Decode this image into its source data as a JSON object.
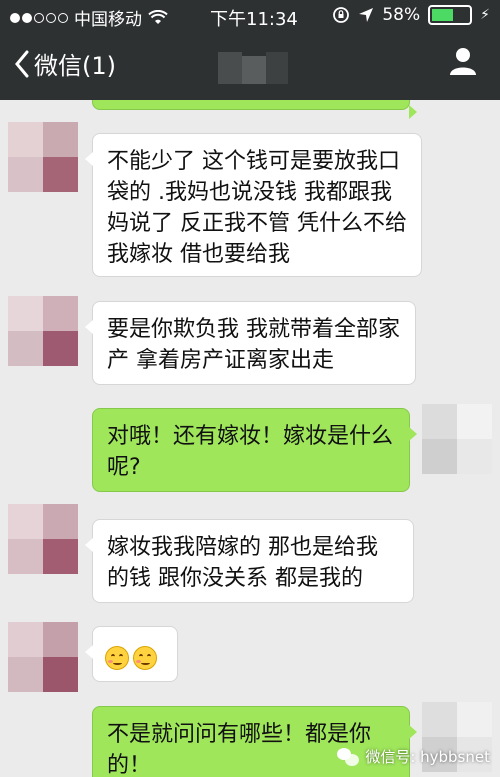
{
  "status_bar": {
    "carrier": "中国移动",
    "time": "下午11:34",
    "battery_percent": "58%",
    "battery_level": 0.58,
    "signal_dots_filled": 2,
    "signal_dots_total": 5
  },
  "nav": {
    "back_label": "微信(1)",
    "back_icon": "chevron-left-icon",
    "contact_icon": "user-icon"
  },
  "messages": [
    {
      "side": "out",
      "text": ""
    },
    {
      "side": "in",
      "text": "不能少了 这个钱可是要放我口袋的 .我妈也说没钱 我都跟我妈说了 反正我不管 凭什么不给我嫁妆 借也要给我"
    },
    {
      "side": "in",
      "text": "要是你欺负我 我就带着全部家产 拿着房产证离家出走"
    },
    {
      "side": "out",
      "text": "对哦！还有嫁妆！嫁妆是什么呢?"
    },
    {
      "side": "in",
      "text": "嫁妆我我陪嫁的 那也是给我的钱 跟你没关系 都是我的"
    },
    {
      "side": "in",
      "emoji": [
        "smiling-face-emoji",
        "smiling-face-emoji"
      ]
    },
    {
      "side": "out",
      "text": "不是就问问有哪些！都是你的！"
    }
  ],
  "watermark": {
    "label": "微信号: hybbsnet"
  },
  "colors": {
    "nav_bg": "#2e3132",
    "chat_bg": "#ebebeb",
    "bubble_out": "#9fe65b",
    "bubble_in": "#ffffff"
  }
}
